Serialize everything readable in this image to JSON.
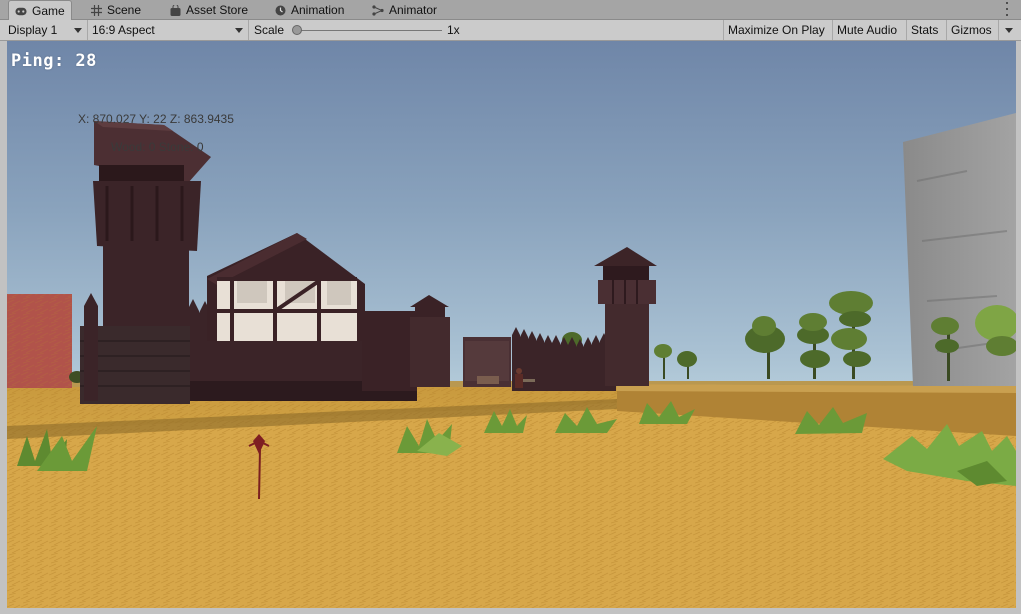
{
  "tabs": [
    {
      "label": "Game",
      "icon": "gamepad-icon",
      "active": true
    },
    {
      "label": "Scene",
      "icon": "grid-icon",
      "active": false
    },
    {
      "label": "Asset Store",
      "icon": "bag-icon",
      "active": false
    },
    {
      "label": "Animation",
      "icon": "clock-icon",
      "active": false
    },
    {
      "label": "Animator",
      "icon": "animator-icon",
      "active": false
    }
  ],
  "toolbar": {
    "display": "Display 1",
    "aspect": "16:9 Aspect",
    "scale_label": "Scale",
    "scale_value": "1x",
    "scale_fraction": 0.0,
    "maximize": "Maximize On Play",
    "mute": "Mute Audio",
    "stats": "Stats",
    "gizmos": "Gizmos"
  },
  "hud": {
    "ping": "Ping: 28",
    "coords": "X: 870.027 Y: 22 Z: 863.9435",
    "resources": "Wood: 0 Stone: 0"
  },
  "colors": {
    "sky_top": "#6f86a8",
    "sky_bottom": "#c3d9e2",
    "ground": "#d9a844",
    "wood": "#3a2328",
    "stone": "#8f8f8f",
    "grass": "#6f9a3c"
  }
}
